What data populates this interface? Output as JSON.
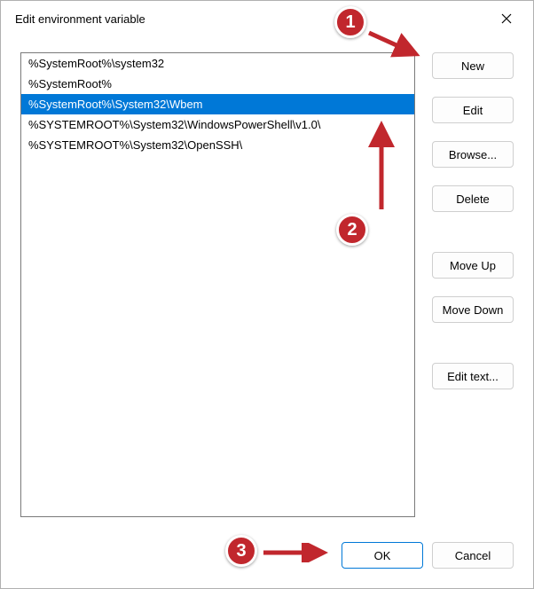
{
  "title": "Edit environment variable",
  "list": {
    "items": [
      "%SystemRoot%\\system32",
      "%SystemRoot%",
      "%SystemRoot%\\System32\\Wbem",
      "%SYSTEMROOT%\\System32\\WindowsPowerShell\\v1.0\\",
      "%SYSTEMROOT%\\System32\\OpenSSH\\"
    ],
    "selected_index": 2
  },
  "buttons": {
    "new": "New",
    "edit": "Edit",
    "browse": "Browse...",
    "delete": "Delete",
    "move_up": "Move Up",
    "move_down": "Move Down",
    "edit_text": "Edit text...",
    "ok": "OK",
    "cancel": "Cancel"
  },
  "annotations": {
    "c1": "1",
    "c2": "2",
    "c3": "3"
  }
}
